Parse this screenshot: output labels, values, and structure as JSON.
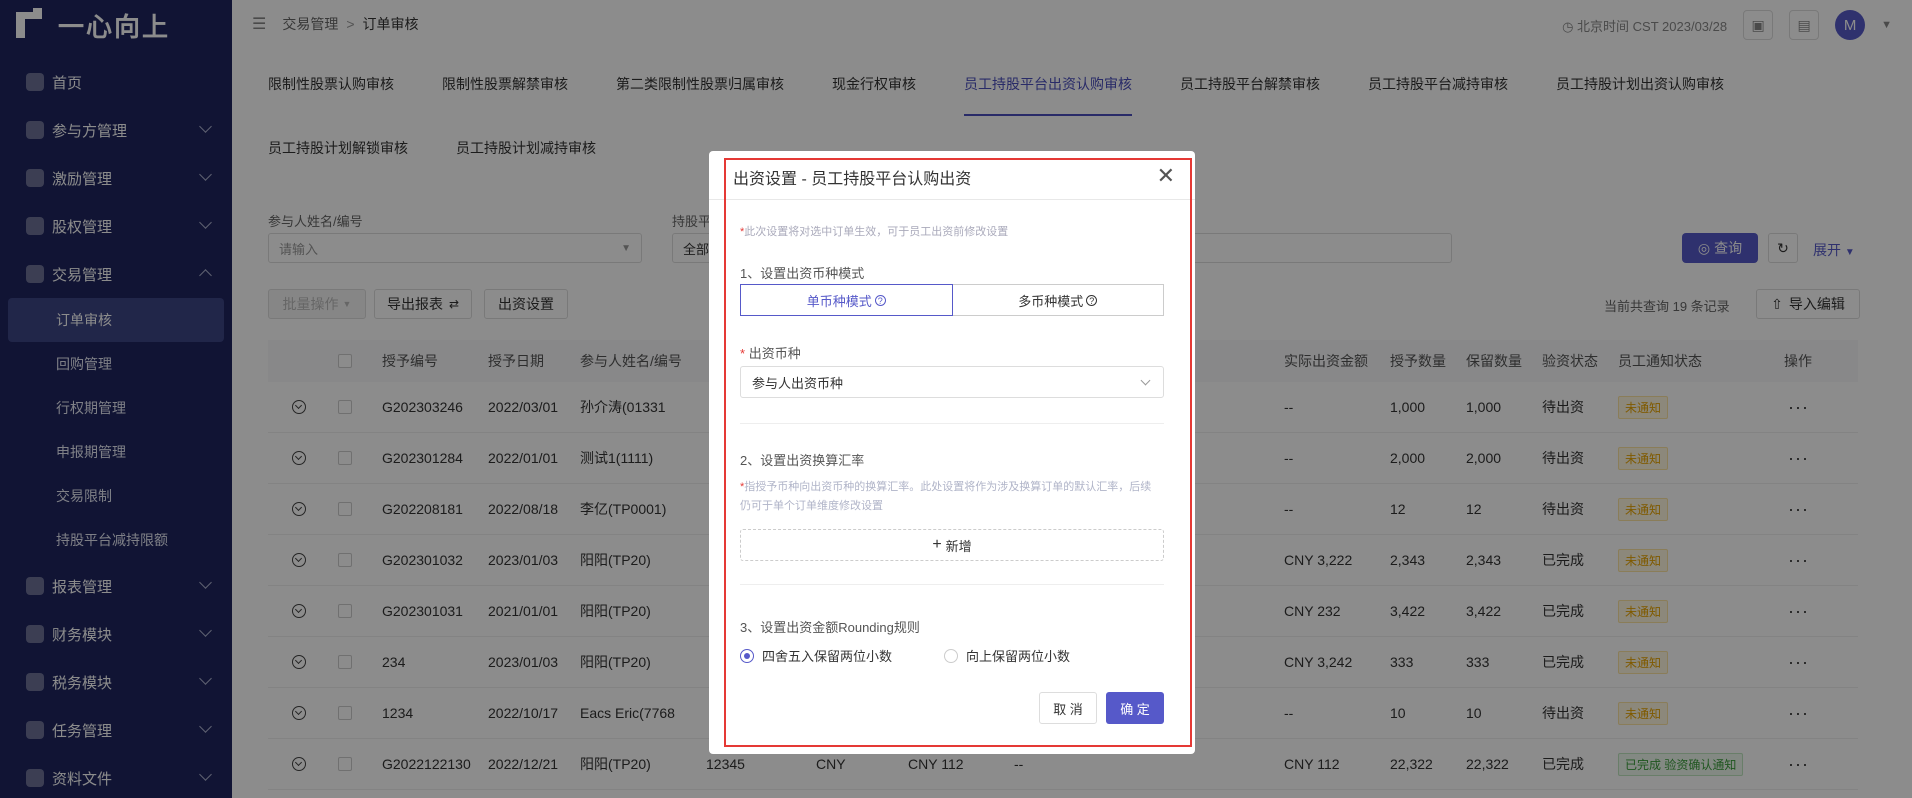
{
  "app": {
    "logo_text": "一心向上"
  },
  "sidebar": {
    "items": [
      {
        "label": "首页",
        "icon": "home-icon"
      },
      {
        "label": "参与方管理",
        "icon": "users-icon"
      },
      {
        "label": "激励管理",
        "icon": "gift-icon"
      },
      {
        "label": "股权管理",
        "icon": "pie-icon"
      },
      {
        "label": "交易管理",
        "icon": "exchange-icon"
      },
      {
        "label": "报表管理",
        "icon": "report-icon"
      },
      {
        "label": "财务模块",
        "icon": "finance-icon"
      },
      {
        "label": "税务模块",
        "icon": "tax-icon"
      },
      {
        "label": "任务管理",
        "icon": "task-icon"
      },
      {
        "label": "资料文件",
        "icon": "folder-icon"
      }
    ],
    "subitems": [
      {
        "label": "订单审核",
        "active": true
      },
      {
        "label": "回购管理"
      },
      {
        "label": "行权期管理"
      },
      {
        "label": "申报期管理"
      },
      {
        "label": "交易限制"
      },
      {
        "label": "持股平台减持限额"
      }
    ]
  },
  "topbar": {
    "breadcrumb_parent": "交易管理",
    "breadcrumb_sep": ">",
    "breadcrumb_current": "订单审核",
    "clock_text": "北京时间 CST 2023/03/28",
    "avatar_letter": "M"
  },
  "tabs": {
    "row1": [
      "限制性股票认购审核",
      "限制性股票解禁审核",
      "第二类限制性股票归属审核",
      "现金行权审核",
      "员工持股平台出资认购审核",
      "员工持股平台解禁审核",
      "员工持股平台减持审核",
      "员工持股计划出资认购审核"
    ],
    "row2": [
      "员工持股计划解锁审核",
      "员工持股计划减持审核"
    ],
    "active": "员工持股平台出资认购审核"
  },
  "filters": {
    "participant_label": "参与人姓名/编号",
    "participant_placeholder": "请输入",
    "platform_label": "持股平",
    "platform_value": "全部",
    "query_label": "查询",
    "expand_label": "展开"
  },
  "toolbar": {
    "batch_label": "批量操作",
    "export_label": "导出报表",
    "setting_label": "出资设置",
    "record_count": "当前共查询 19 条记录",
    "import_label": "导入编辑"
  },
  "table": {
    "headers": [
      "授予编号",
      "授予日期",
      "参与人姓名/编号",
      "实际出资金额",
      "授予数量",
      "保留数量",
      "验资状态",
      "员工通知状态",
      "操作"
    ],
    "rows": [
      {
        "id": "G202303246",
        "date": "2022/03/01",
        "name": "孙介涛(01331",
        "amount": "--",
        "qty": "1,000",
        "keep": "1,000",
        "status": "待出资",
        "notify": "未通知"
      },
      {
        "id": "G202301284",
        "date": "2022/01/01",
        "name": "测试1(1111)",
        "amount": "--",
        "qty": "2,000",
        "keep": "2,000",
        "status": "待出资",
        "notify": "未通知"
      },
      {
        "id": "G202208181",
        "date": "2022/08/18",
        "name": "李亿(TP0001)",
        "amount": "--",
        "qty": "12",
        "keep": "12",
        "status": "待出资",
        "notify": "未通知"
      },
      {
        "id": "G202301032",
        "date": "2023/01/03",
        "name": "阳阳(TP20)",
        "amount": "CNY 3,222",
        "qty": "2,343",
        "keep": "2,343",
        "status": "已完成",
        "notify": "未通知"
      },
      {
        "id": "G202301031",
        "date": "2021/01/01",
        "name": "阳阳(TP20)",
        "amount": "CNY 232",
        "qty": "3,422",
        "keep": "3,422",
        "status": "已完成",
        "notify": "未通知"
      },
      {
        "id": "234",
        "date": "2023/01/03",
        "name": "阳阳(TP20)",
        "amount": "CNY 3,242",
        "qty": "333",
        "keep": "333",
        "status": "已完成",
        "notify": "未通知"
      },
      {
        "id": "1234",
        "date": "2022/10/17",
        "name": "Eacs Eric(7768",
        "amount": "--",
        "qty": "10",
        "keep": "10",
        "status": "待出资",
        "notify": "未通知"
      },
      {
        "id": "G2022122130",
        "date": "2022/12/21",
        "name": "阳阳(TP20)",
        "extra1": "12345",
        "extra2": "CNY",
        "extra3": "CNY 112",
        "extra4": "--",
        "amount": "CNY 112",
        "qty": "22,322",
        "keep": "22,322",
        "status": "已完成",
        "notify": "已完成 验资确认通知"
      }
    ],
    "op_symbol": "···"
  },
  "modal": {
    "title": "出资设置 - 员工持股平台认购出资",
    "close_symbol": "✕",
    "hint_star": "*",
    "hint": "此次设置将对选中订单生效，可于员工出资前修改设置",
    "section1": "1、设置出资币种模式",
    "mode_single": "单币种模式",
    "mode_multi": "多币种模式",
    "q_symbol": "?",
    "currency_label": "出资币种",
    "currency_value": "参与人出资币种",
    "section2": "2、设置出资换算汇率",
    "rate_note": "指授予币种向出资币种的换算汇率。此处设置将作为涉及换算订单的默认汇率，后续仍可于单个订单维度修改设置",
    "add_label": "新增",
    "add_symbol": "+",
    "section3": "3、设置出资金额Rounding规则",
    "round_half": "四舍五入保留两位小数",
    "round_up": "向上保留两位小数",
    "cancel_label": "取 消",
    "ok_label": "确 定"
  },
  "colors": {
    "sidebar_bg": "#1f2660",
    "accent": "#5659c9",
    "highlight_frame": "#e53935"
  }
}
